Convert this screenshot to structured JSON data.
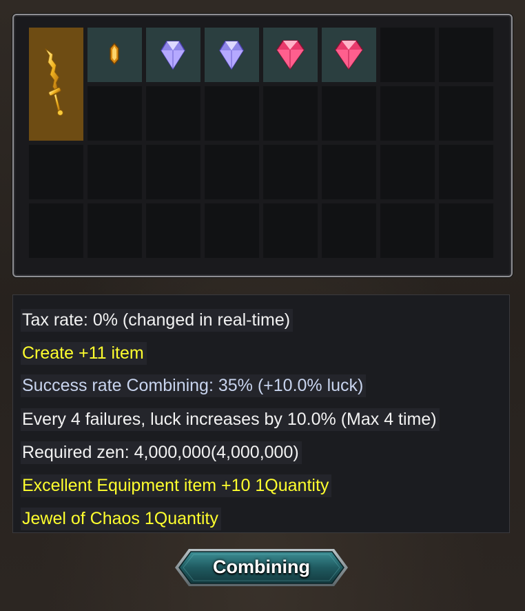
{
  "inventory": {
    "items": [
      {
        "name": "golden-sword-icon",
        "slot": "0-0",
        "color": "#6e4c13"
      },
      {
        "name": "amber-jewel-icon",
        "slot": "0-1",
        "color": "#2b3f40"
      },
      {
        "name": "purple-gem-icon",
        "slot": "0-2",
        "color": "#2b3f40"
      },
      {
        "name": "purple-gem-icon",
        "slot": "0-3",
        "color": "#2b3f40"
      },
      {
        "name": "pink-gem-icon",
        "slot": "0-4",
        "color": "#2b3f40"
      },
      {
        "name": "pink-gem-icon",
        "slot": "0-5",
        "color": "#2b3f40"
      }
    ]
  },
  "info": {
    "tax_rate": "Tax rate: 0% (changed in real-time)",
    "create": "Create +11 item",
    "success_rate": "Success rate Combining: 35% (+10.0% luck)",
    "luck_note": "Every 4 failures, luck increases by 10.0% (Max 4 time)",
    "required_zen": "Required zen: 4,000,000(4,000,000)",
    "req_item_1": "Excellent Equipment item +10 1Quantity",
    "req_item_2": "Jewel of Chaos 1Quantity"
  },
  "colors": {
    "white_text": "#f2f2f2",
    "yellow_text": "#ffff2e",
    "blue_text": "#c8d4ee",
    "slot_filled": "#2b3f40",
    "slot_weapon": "#6e4c13"
  },
  "combine_button": {
    "label": "Combining"
  }
}
